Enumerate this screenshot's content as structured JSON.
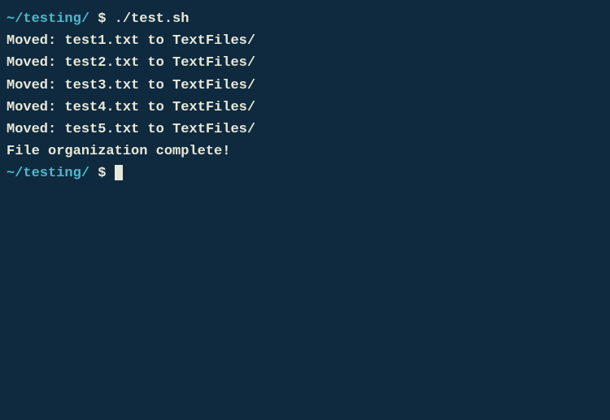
{
  "prompt1": {
    "path": "~/testing/",
    "dollar": " $ ",
    "command": "./test.sh"
  },
  "output": {
    "line1": "Moved: test1.txt to TextFiles/",
    "line2": "Moved: test2.txt to TextFiles/",
    "line3": "Moved: test3.txt to TextFiles/",
    "line4": "Moved: test4.txt to TextFiles/",
    "line5": "Moved: test5.txt to TextFiles/",
    "line6": "File organization complete!"
  },
  "prompt2": {
    "path": "~/testing/",
    "dollar": " $ "
  }
}
